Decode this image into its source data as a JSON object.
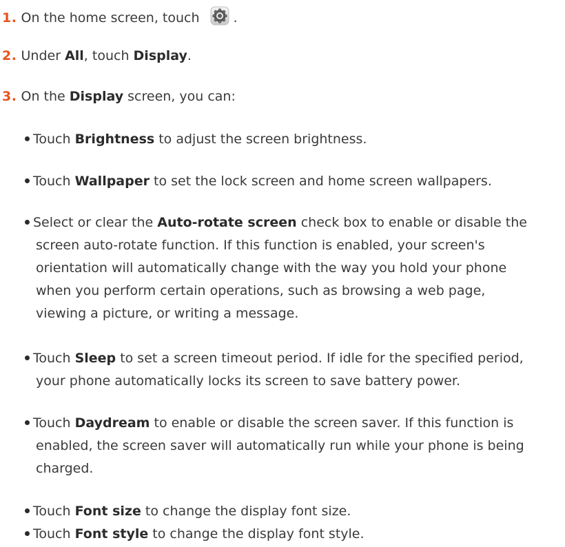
{
  "steps": [
    {
      "num": "1.",
      "pre": "On the home screen, touch",
      "icon": "settings-gear-icon",
      "post": "."
    },
    {
      "num": "2.",
      "pre": "Under ",
      "b1": "All",
      "mid": ", touch ",
      "b2": "Display",
      "post": "."
    },
    {
      "num": "3.",
      "pre": "On the ",
      "b1": "Display",
      "post": " screen, you can:"
    }
  ],
  "bullets": [
    {
      "pre": "Touch ",
      "b": "Brightness",
      "post": " to adjust the screen brightness."
    },
    {
      "pre": "Touch ",
      "b": "Wallpaper",
      "post": " to set the lock screen and home screen wallpapers."
    },
    {
      "pre": "Select or clear the ",
      "b": "Auto-rotate screen",
      "l1": " check box to enable or disable the",
      "l2": "screen auto-rotate function. If this function is enabled, your screen's",
      "l3": "orientation will automatically change with the way you hold your phone",
      "l4": "when you perform certain operations, such as browsing a web page,",
      "l5": "viewing a picture, or writing a message."
    },
    {
      "pre": "Touch ",
      "b": "Sleep",
      "l1": " to set a screen timeout period. If idle for the specified period,",
      "l2": "your phone automatically locks its screen to save battery power."
    },
    {
      "pre": "Touch ",
      "b": "Daydream",
      "l1": " to enable or disable the screen saver. If this function is",
      "l2": "enabled, the screen saver will automatically run while your phone is being",
      "l3": "charged."
    },
    {
      "pre": "Touch ",
      "b": "Font size",
      "post": " to change the display font size."
    },
    {
      "pre": "Touch ",
      "b": "Font style",
      "post": " to change the display font style."
    }
  ]
}
